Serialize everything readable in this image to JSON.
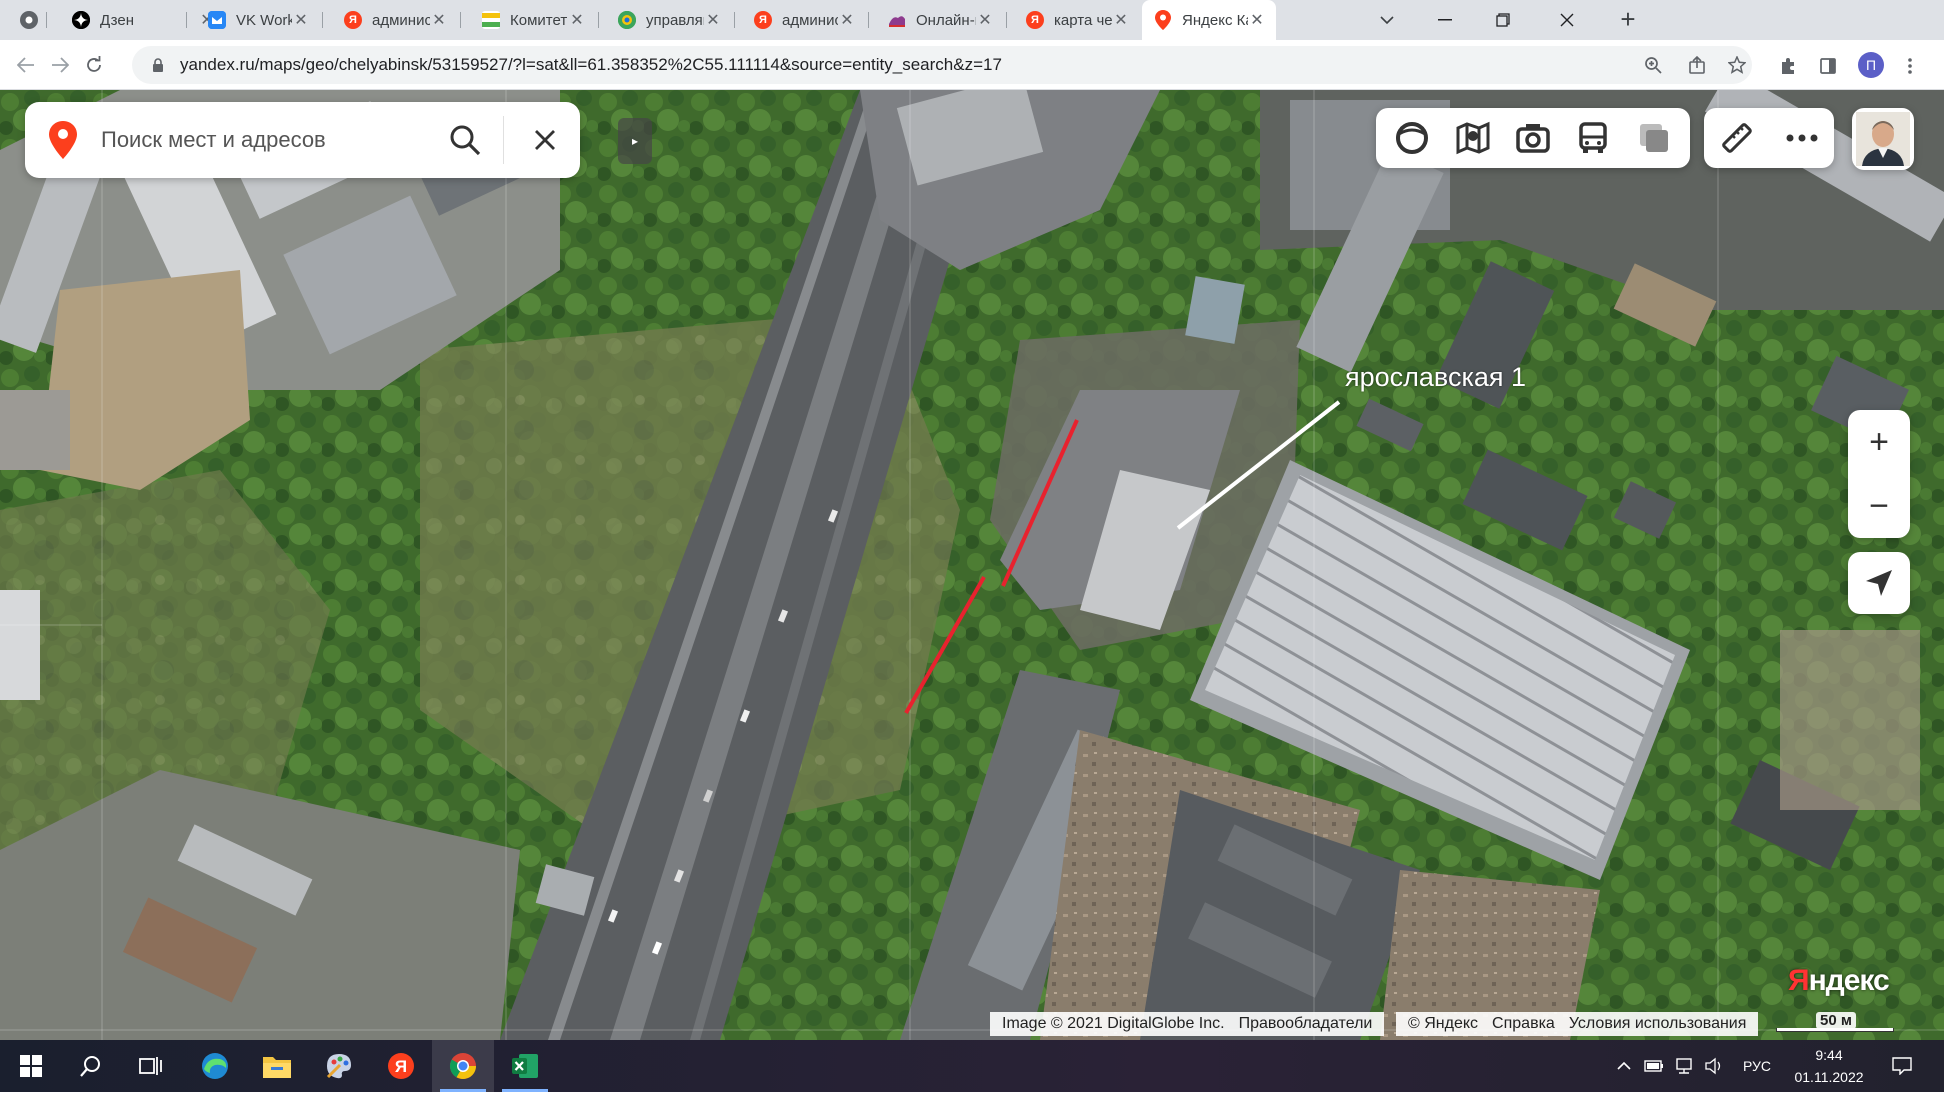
{
  "browser": {
    "tabs": [
      {
        "title": "",
        "favicon": "chrome-icon",
        "color": "#5f6368"
      },
      {
        "title": "Дзен",
        "favicon": "dzen-icon",
        "color": "#000000"
      },
      {
        "title": "VK WorkMail",
        "favicon": "vk-workmail-icon",
        "color": "#2787f5"
      },
      {
        "title": "администрац",
        "favicon": "yandex-icon",
        "color": "#fc3f1d"
      },
      {
        "title": "Комитет дор",
        "favicon": "committee-icon",
        "color": "#4caf50"
      },
      {
        "title": "управляющи",
        "favicon": "management-icon",
        "color": "#3ba55c"
      },
      {
        "title": "администрац",
        "favicon": "yandex-icon",
        "color": "#fc3f1d"
      },
      {
        "title": "Онлайн-при",
        "favicon": "online-icon",
        "color": "#8e3b8e"
      },
      {
        "title": "карта челяби",
        "favicon": "yandex-icon",
        "color": "#fc3f1d"
      },
      {
        "title": "Яндекс Карт",
        "favicon": "yandex-maps-icon",
        "color": "#fc3f1d"
      }
    ],
    "url": "yandex.ru/maps/geo/chelyabinsk/53159527/?l=sat&ll=61.358352%2C55.111114&source=entity_search&z=17",
    "profile_initial": "П",
    "profile_color": "#5b5fc7"
  },
  "map": {
    "search_placeholder": "Поиск мест и адресов",
    "annotation_label": "ярославская  1",
    "logo_y": "Я",
    "logo_rest": "ндекс",
    "copyright_left": "Image © 2021 DigitalGlobe Inc.",
    "copyright_owners": "Правообладатели",
    "copyright_yandex": "© Яндекс",
    "copyright_help": "Справка",
    "copyright_terms": "Условия использования",
    "scale_label": "50 м",
    "zoom_in": "+",
    "zoom_out": "−",
    "collapse_glyph": "▸",
    "layer_buttons": [
      "panorama-circle-icon",
      "map-layers-icon",
      "camera-icon",
      "bus-icon",
      "layers-square-icon"
    ],
    "tool_buttons": [
      "ruler-icon",
      "more-icon"
    ],
    "marker_color": "#e8222e",
    "pointer_color": "#ffffff"
  },
  "taskbar": {
    "apps": [
      "windows-start-icon",
      "search-icon",
      "task-view-icon",
      "edge-icon",
      "file-explorer-icon",
      "paint-icon",
      "yandex-browser-icon",
      "chrome-icon",
      "excel-icon"
    ],
    "language": "РУС",
    "time": "9:44",
    "date": "01.11.2022"
  }
}
